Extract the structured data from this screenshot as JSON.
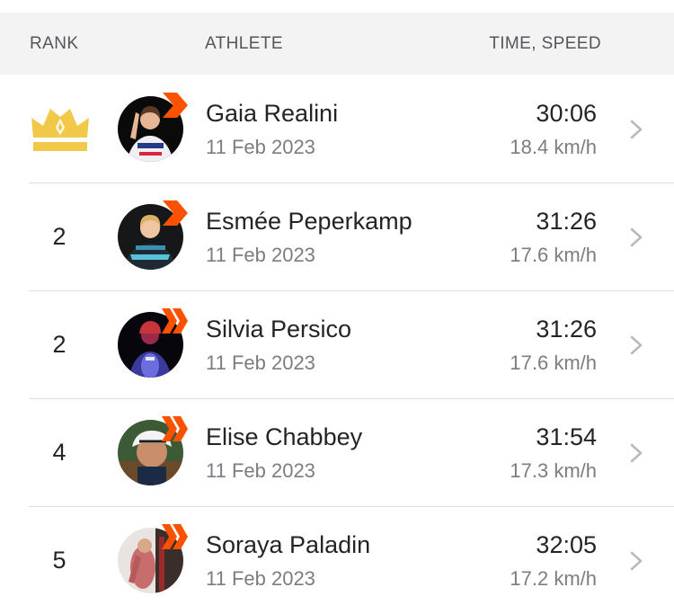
{
  "header": {
    "rank_label": "RANK",
    "athlete_label": "ATHLETE",
    "time_label": "TIME, SPEED"
  },
  "colors": {
    "crown": "#f2c849",
    "badge": "#fc5200",
    "chevron": "#b9b9be",
    "divider": "#dedee0",
    "header_bg": "#f3f3f4"
  },
  "rows": [
    {
      "rank": "",
      "crown": true,
      "name": "Gaia Realini",
      "date": "11 Feb 2023",
      "time": "30:06",
      "speed": "18.4 km/h"
    },
    {
      "rank": "2",
      "crown": false,
      "name": "Esmée Peperkamp",
      "date": "11 Feb 2023",
      "time": "31:26",
      "speed": "17.6 km/h"
    },
    {
      "rank": "2",
      "crown": false,
      "name": "Silvia Persico",
      "date": "11 Feb 2023",
      "time": "31:26",
      "speed": "17.6 km/h"
    },
    {
      "rank": "4",
      "crown": false,
      "name": "Elise Chabbey",
      "date": "11 Feb 2023",
      "time": "31:54",
      "speed": "17.3 km/h"
    },
    {
      "rank": "5",
      "crown": false,
      "name": "Soraya Paladin",
      "date": "11 Feb 2023",
      "time": "32:05",
      "speed": "17.2 km/h"
    }
  ],
  "icons": {
    "crown": "crown-icon",
    "badge": "subscriber-badge-icon",
    "chevron": "chevron-right-icon"
  }
}
